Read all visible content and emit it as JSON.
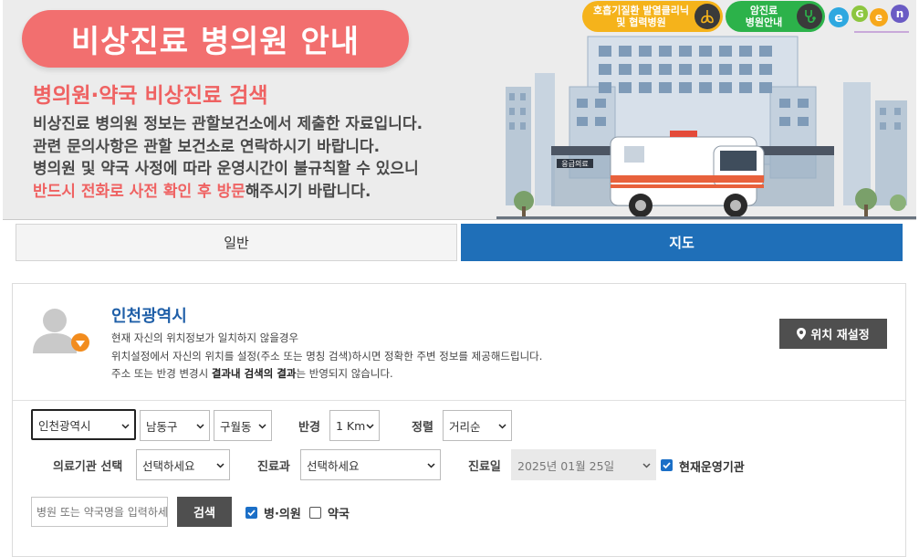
{
  "banner": {
    "title": "비상진료 병의원 안내",
    "subtitle": "병의원·약국 비상진료 검색",
    "line1": "비상진료 병의원 정보는 관할보건소에서 제출한 자료입니다.",
    "line2": "관련 문의사항은 관할 보건소로 연락하시기 바랍니다.",
    "line3": "병의원 및 약국 사정에 따라 운영시간이 불규칙할 수 있으니",
    "line4_highlight": "반드시 전화로 사전 확인 후 방문",
    "line4_rest": "해주시기 바랍니다.",
    "badge_respiratory_line1": "호흡기질환 발열클리닉",
    "badge_respiratory_line2": "및 협력병원",
    "badge_cancer_line1": "암진료",
    "badge_cancer_line2": "병원안내",
    "ambulance_sign": "응급의료"
  },
  "tabs": {
    "general": "일반",
    "map": "지도"
  },
  "location": {
    "city": "인천광역시",
    "desc1": "현재 자신의 위치정보가 일치하지 않을경우",
    "desc2": "위치설정에서 자신의 위치를 설정(주소 또는 명칭 검색)하시면 정확한 주변 정보를 제공해드립니다.",
    "desc3_pre": "주소 또는 반경 변경시 ",
    "desc3_bold": "결과내 검색의 결과",
    "desc3_post": "는 반영되지 않습니다.",
    "reset_button": "위치 재설정"
  },
  "filters": {
    "city": "인천광역시",
    "district": "남동구",
    "dong": "구월동",
    "radius_label": "반경",
    "radius": "1 Km",
    "sort_label": "정렬",
    "sort": "거리순",
    "institution_label": "의료기관 선택",
    "institution": "선택하세요",
    "department_label": "진료과",
    "department": "선택하세요",
    "date_label": "진료일",
    "date": "2025년 01월 25일",
    "open_now": "현재운영기관",
    "open_now_checked": true,
    "search_placeholder": "병원 또는 약국명을 입력하세요",
    "search_button": "검색",
    "type_clinic": "병·의원",
    "type_clinic_checked": true,
    "type_pharmacy": "약국",
    "type_pharmacy_checked": false
  },
  "colors": {
    "accent_red": "#f26f6f",
    "tab_active": "#1f6fb8",
    "dark_button": "#4f4f4f",
    "city_blue": "#1f5fa8",
    "checkbox_blue": "#1b6fc7"
  }
}
